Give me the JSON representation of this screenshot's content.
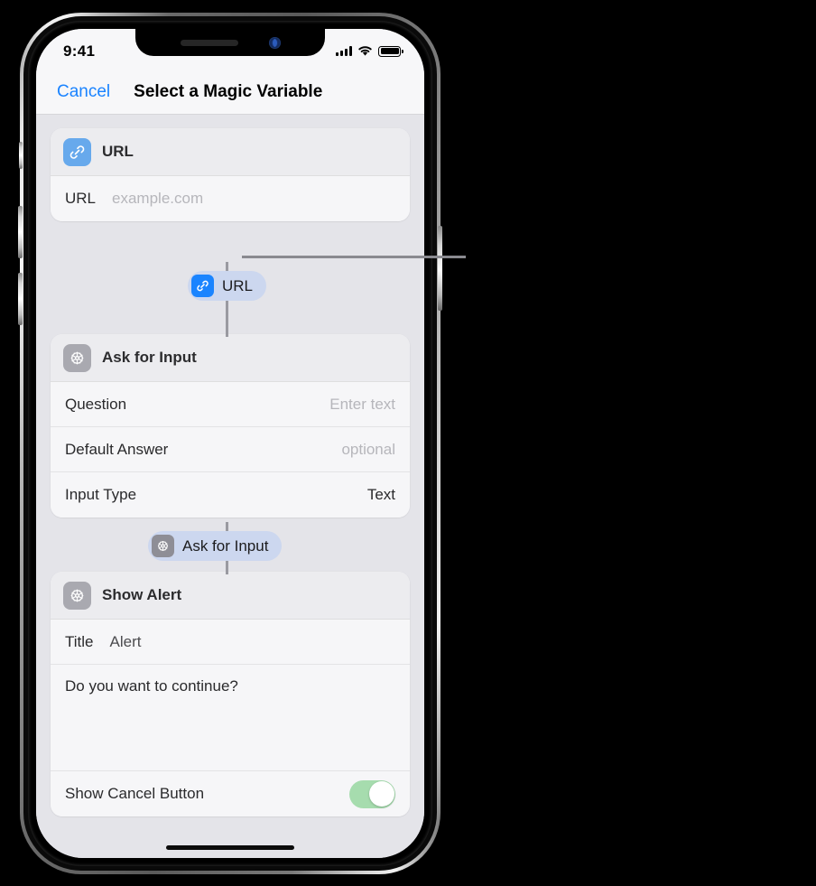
{
  "status_bar": {
    "time": "9:41",
    "cellular_icon": "cellular-signal-icon",
    "wifi_icon": "wifi-icon",
    "battery_icon": "battery-icon"
  },
  "nav_bar": {
    "cancel_label": "Cancel",
    "title": "Select a Magic Variable"
  },
  "cards": [
    {
      "id": "url-action",
      "icon": "link-icon",
      "icon_color": "#67a9ec",
      "title": "URL",
      "rows": [
        {
          "label": "URL",
          "value": "example.com",
          "is_placeholder": true,
          "style": "inline"
        }
      ]
    },
    {
      "id": "ask-for-input-action",
      "icon": "gear-icon",
      "icon_color": "#a9a9b0",
      "title": "Ask for Input",
      "rows": [
        {
          "label": "Question",
          "value": "Enter text",
          "is_placeholder": true,
          "style": "right"
        },
        {
          "label": "Default Answer",
          "value": "optional",
          "is_placeholder": true,
          "style": "right"
        },
        {
          "label": "Input Type",
          "value": "Text",
          "is_placeholder": false,
          "style": "right"
        }
      ]
    },
    {
      "id": "show-alert-action",
      "icon": "gear-icon",
      "icon_color": "#a9a9b0",
      "title": "Show Alert",
      "title_row": {
        "label": "Title",
        "value": "Alert"
      },
      "message": "Do you want to continue?",
      "toggle_row": {
        "label": "Show Cancel Button",
        "state": "on",
        "track_color": "#a6dcae"
      }
    }
  ],
  "magic_variables": [
    {
      "id": "url-variable",
      "icon": "link-icon",
      "icon_color": "#1a84ff",
      "label": "URL",
      "selected": true
    },
    {
      "id": "ask-for-input-variable",
      "icon": "gear-icon",
      "icon_color": "#8e8e96",
      "label": "Ask for Input",
      "selected": false
    }
  ],
  "colors": {
    "accent_blue": "#1a83ff",
    "screen_background": "#e4e4e9",
    "card_background": "#f6f6f8",
    "connector": "#8a8a90",
    "toggle_on": "#a6dcae"
  }
}
